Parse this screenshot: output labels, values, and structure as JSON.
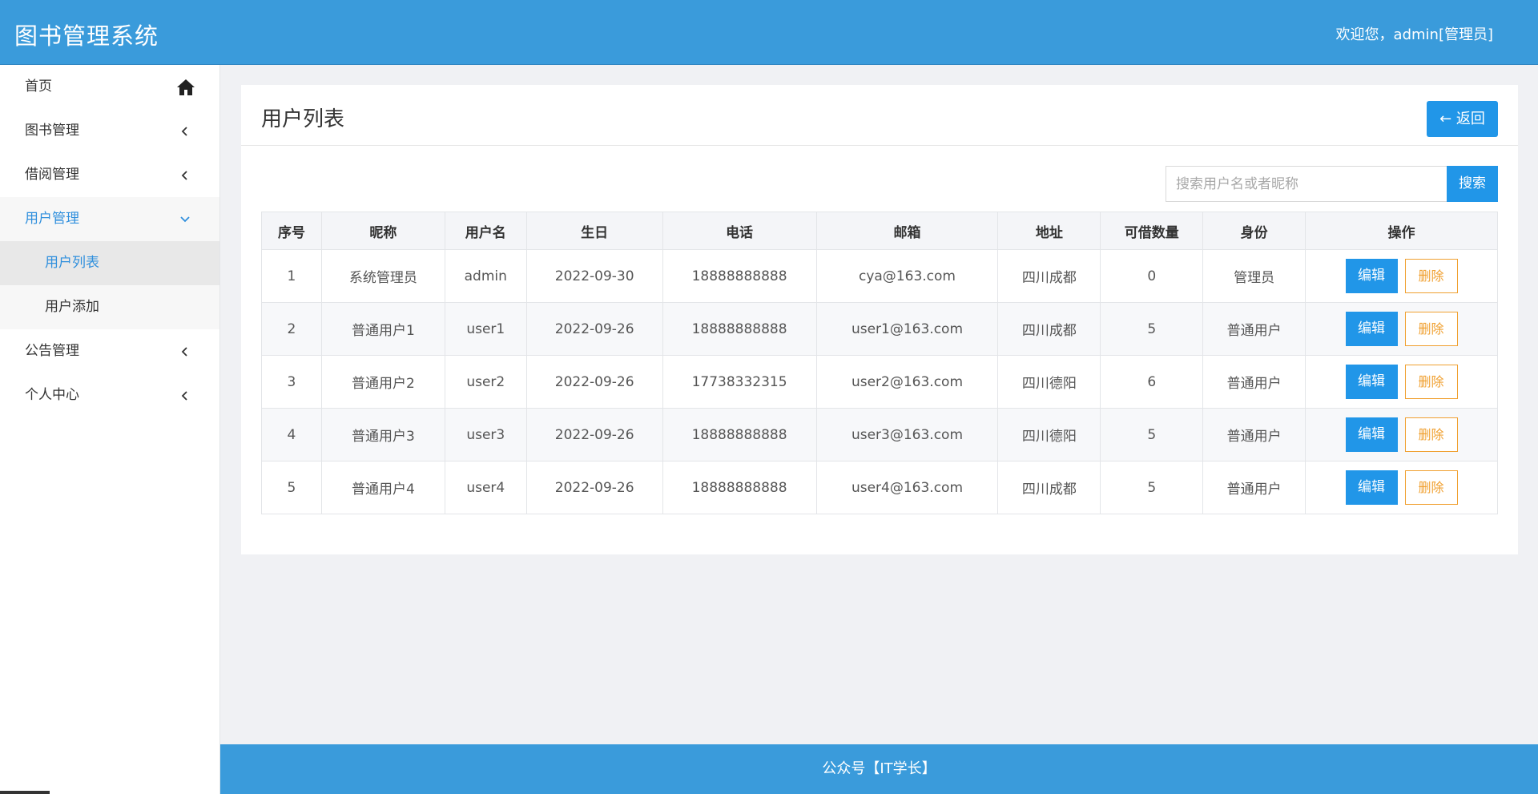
{
  "header": {
    "app_title": "图书管理系统",
    "welcome": "欢迎您，admin[管理员]"
  },
  "sidebar": {
    "items": [
      {
        "label": "首页",
        "icon": "home-icon"
      },
      {
        "label": "图书管理",
        "icon": "chevron-left-icon"
      },
      {
        "label": "借阅管理",
        "icon": "chevron-left-icon"
      },
      {
        "label": "用户管理",
        "icon": "chevron-down-icon",
        "expanded": true
      },
      {
        "label": "公告管理",
        "icon": "chevron-left-icon"
      },
      {
        "label": "个人中心",
        "icon": "chevron-left-icon"
      }
    ],
    "user_submenu": [
      {
        "label": "用户列表",
        "current": true
      },
      {
        "label": "用户添加"
      }
    ]
  },
  "panel": {
    "title": "用户列表",
    "back_label": "返回",
    "search_placeholder": "搜索用户名或者昵称",
    "search_label": "搜索"
  },
  "table": {
    "headers": [
      "序号",
      "昵称",
      "用户名",
      "生日",
      "电话",
      "邮箱",
      "地址",
      "可借数量",
      "身份",
      "操作"
    ],
    "rows": [
      [
        "1",
        "系统管理员",
        "admin",
        "2022-09-30",
        "18888888888",
        "cya@163.com",
        "四川成都",
        "0",
        "管理员"
      ],
      [
        "2",
        "普通用户1",
        "user1",
        "2022-09-26",
        "18888888888",
        "user1@163.com",
        "四川成都",
        "5",
        "普通用户"
      ],
      [
        "3",
        "普通用户2",
        "user2",
        "2022-09-26",
        "17738332315",
        "user2@163.com",
        "四川德阳",
        "6",
        "普通用户"
      ],
      [
        "4",
        "普通用户3",
        "user3",
        "2022-09-26",
        "18888888888",
        "user3@163.com",
        "四川德阳",
        "5",
        "普通用户"
      ],
      [
        "5",
        "普通用户4",
        "user4",
        "2022-09-26",
        "18888888888",
        "user4@163.com",
        "四川成都",
        "5",
        "普通用户"
      ]
    ],
    "edit_label": "编辑",
    "delete_label": "删除"
  },
  "footer": {
    "text": "公众号【IT学长】"
  },
  "colors": {
    "header_bg": "#3a9bdb",
    "primary": "#2196e8",
    "warning": "#f0a030",
    "active_text": "#2f8fdd"
  }
}
